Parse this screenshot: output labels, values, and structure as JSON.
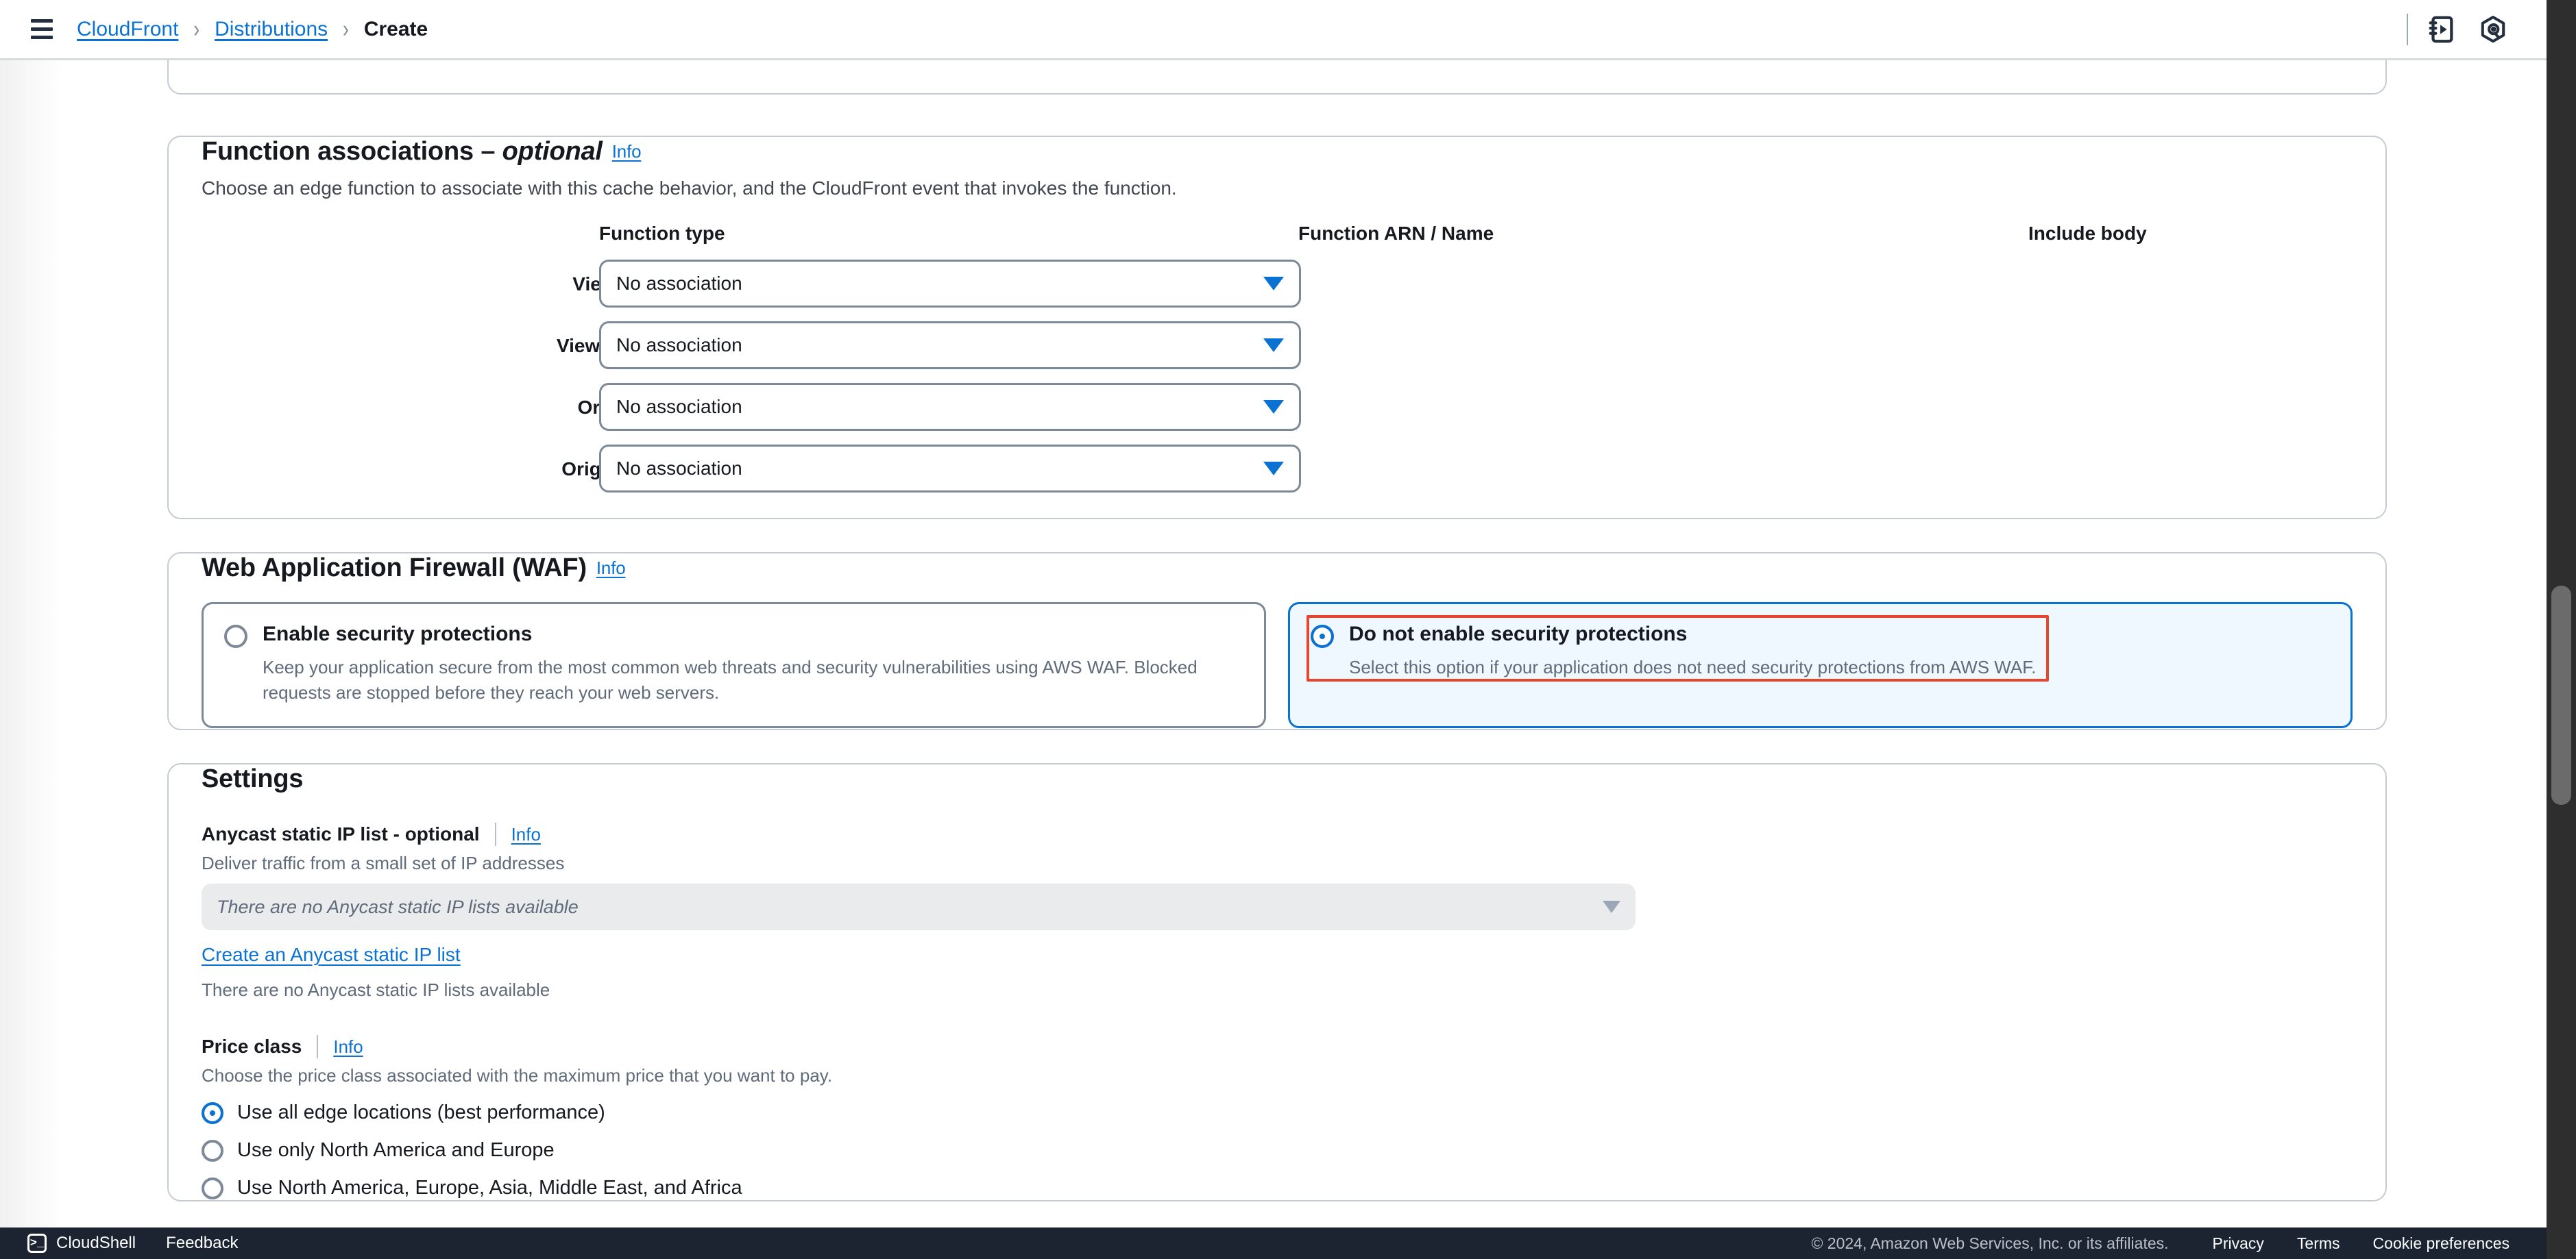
{
  "topbar": {
    "menu_icon": "hamburger-menu-icon",
    "breadcrumb": [
      {
        "label": "CloudFront",
        "current": false
      },
      {
        "label": "Distributions",
        "current": false
      },
      {
        "label": "Create",
        "current": true
      }
    ],
    "separator": "›",
    "icons": [
      {
        "name": "tutorials-icon"
      },
      {
        "name": "amazon-q-icon"
      }
    ]
  },
  "function_associations": {
    "title": "Function associations – ",
    "title_optional": "optional",
    "info": "Info",
    "description": "Choose an edge function to associate with this cache behavior, and the CloudFront event that invokes the function.",
    "columns": {
      "type": "Function type",
      "arn": "Function ARN / Name",
      "include_body": "Include body"
    },
    "rows": [
      {
        "label": "Viewer request",
        "value": "No association"
      },
      {
        "label": "Viewer response",
        "value": "No association"
      },
      {
        "label": "Origin request",
        "value": "No association"
      },
      {
        "label": "Origin response",
        "value": "No association"
      }
    ]
  },
  "waf": {
    "title": "Web Application Firewall (WAF)",
    "info": "Info",
    "options": [
      {
        "title": "Enable security protections",
        "desc": "Keep your application secure from the most common web threats and security vulnerabilities using AWS WAF. Blocked requests are stopped before they reach your web servers.",
        "selected": false,
        "highlighted": false
      },
      {
        "title": "Do not enable security protections",
        "desc": "Select this option if your application does not need security protections from AWS WAF.",
        "selected": true,
        "highlighted": true
      }
    ]
  },
  "settings": {
    "title": "Settings",
    "anycast": {
      "label": "Anycast static IP list - optional",
      "info": "Info",
      "hint": "Deliver traffic from a small set of IP addresses",
      "select_value": "There are no Anycast static IP lists available",
      "create_link": "Create an Anycast static IP list",
      "note": "There are no Anycast static IP lists available"
    },
    "price_class": {
      "label": "Price class",
      "info": "Info",
      "hint": "Choose the price class associated with the maximum price that you want to pay.",
      "options": [
        {
          "label": "Use all edge locations (best performance)",
          "selected": true
        },
        {
          "label": "Use only North America and Europe",
          "selected": false
        },
        {
          "label": "Use North America, Europe, Asia, Middle East, and Africa",
          "selected": false
        }
      ]
    }
  },
  "footer": {
    "cloudshell": "CloudShell",
    "cloudshell_glyph": ">_",
    "feedback": "Feedback",
    "copyright": "© 2024, Amazon Web Services, Inc. or its affiliates.",
    "links": [
      "Privacy",
      "Terms",
      "Cookie preferences"
    ]
  },
  "colors": {
    "accent": "#0972d3",
    "highlight": "#e8452c",
    "selected_tile_bg": "#f0f8ff",
    "footer_bg": "#1b2430"
  }
}
